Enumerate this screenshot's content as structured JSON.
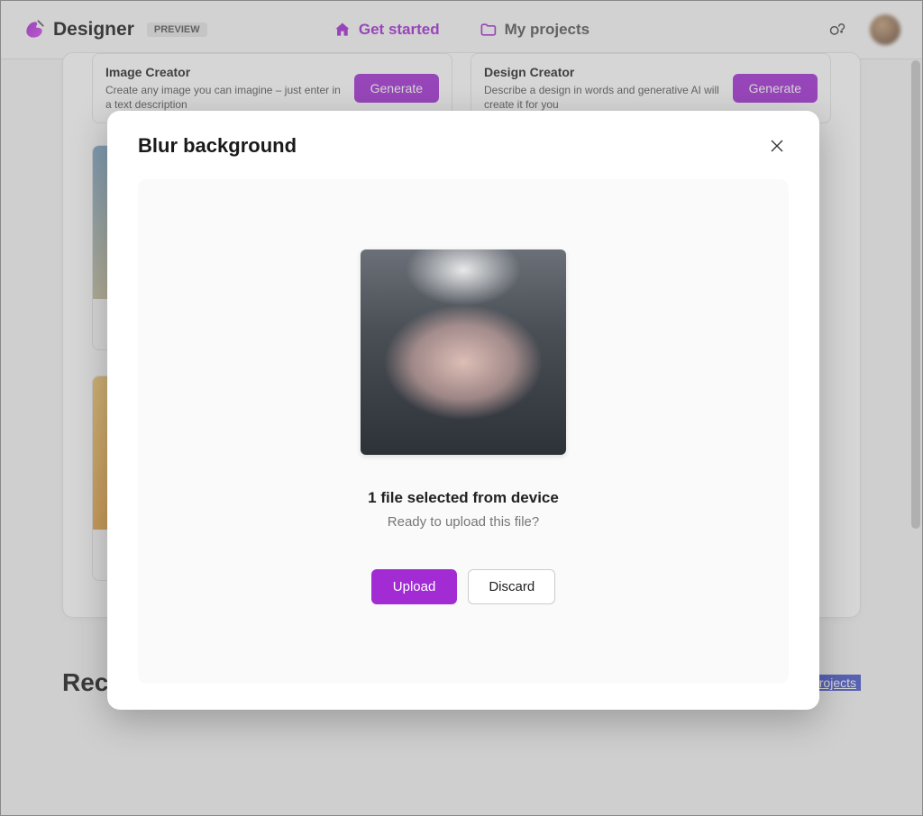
{
  "header": {
    "brand": "Designer",
    "badge": "PREVIEW",
    "nav": {
      "get_started": "Get started",
      "my_projects": "My projects"
    }
  },
  "tools": {
    "image_creator": {
      "title": "Image Creator",
      "desc": "Create any image you can imagine – just enter in a text description",
      "button": "Generate"
    },
    "design_creator": {
      "title": "Design Creator",
      "desc": "Describe a design in words and generative AI will create it for you",
      "button": "Generate"
    }
  },
  "recent": {
    "title": "Recent projects",
    "show_all": "Show all projects"
  },
  "modal": {
    "title": "Blur background",
    "selected": "1 file selected from device",
    "ready": "Ready to upload this file?",
    "upload": "Upload",
    "discard": "Discard"
  }
}
